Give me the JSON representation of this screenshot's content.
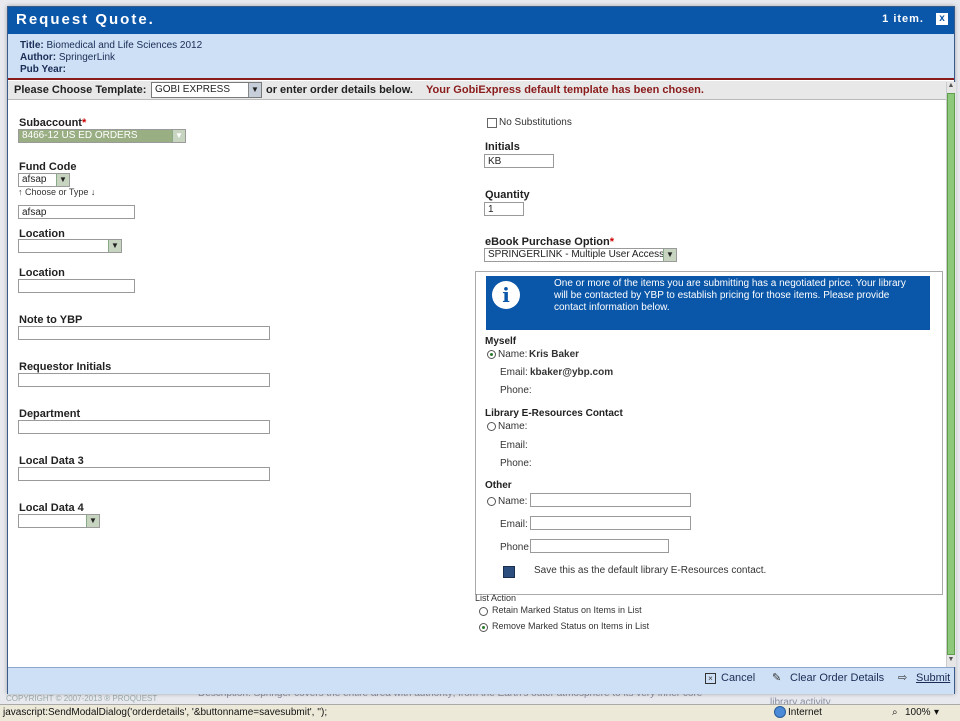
{
  "background": {
    "description": "Description: Springer covers the entire area with authority; from the Earth's outer atmosphere to its very inner core",
    "copyright": "COPYRIGHT © 2007-2013 ® PROQUEST",
    "library_activity": "library activity"
  },
  "modal": {
    "title": "Request Quote.",
    "items_count": "1 item.",
    "close_label": "x"
  },
  "info": {
    "title_label": "Title:",
    "title_value": "Biomedical and Life Sciences 2012",
    "author_label": "Author:",
    "author_value": "SpringerLink",
    "pubyear_label": "Pub Year:"
  },
  "template": {
    "label": "Please Choose Template:",
    "selected": "GOBI EXPRESS",
    "or_text": "or enter order details below.",
    "message": "Your GobiExpress default template has been chosen."
  },
  "left": {
    "subaccount_label": "Subaccount",
    "subaccount_value": "8466-12 US ED ORDERS",
    "fund_code_label": "Fund Code",
    "fund_code_value": "afsap",
    "choose_or_type": "Choose or Type",
    "fund_text_value": "afsap",
    "location_label": "Location",
    "location2_label": "Location",
    "note_label": "Note to YBP",
    "requestor_label": "Requestor Initials",
    "department_label": "Department",
    "local3_label": "Local Data 3",
    "local4_label": "Local Data 4"
  },
  "right": {
    "no_subs_label": "No Substitutions",
    "initials_label": "Initials",
    "initials_value": "KB",
    "quantity_label": "Quantity",
    "quantity_value": "1",
    "ebook_label": "eBook Purchase Option",
    "ebook_value": "SPRINGERLINK - Multiple User Access"
  },
  "notice": {
    "icon": "i",
    "text": "One or more of the items you are submitting has a negotiated price. Your library will be contacted by YBP to establish pricing for those items. Please provide contact information below."
  },
  "contact": {
    "myself_heading": "Myself",
    "name_label": "Name:",
    "myself_name": "Kris Baker",
    "email_label": "Email:",
    "myself_email": "kbaker@ybp.com",
    "phone_label": "Phone:",
    "phone_label_nocolon": "Phone",
    "library_heading": "Library E-Resources Contact",
    "other_heading": "Other",
    "save_default": "Save this as the default library E-Resources contact."
  },
  "list_action": {
    "heading": "List Action",
    "retain": "Retain Marked Status on Items in List",
    "remove": "Remove Marked Status on Items in List"
  },
  "footer": {
    "cancel": "Cancel",
    "clear": "Clear Order Details",
    "submit": "Submit"
  },
  "statusbar": {
    "text": "javascript:SendModalDialog('orderdetails', '&buttonname=savesubmit', '');",
    "zone": "Internet",
    "zoom": "100%"
  }
}
